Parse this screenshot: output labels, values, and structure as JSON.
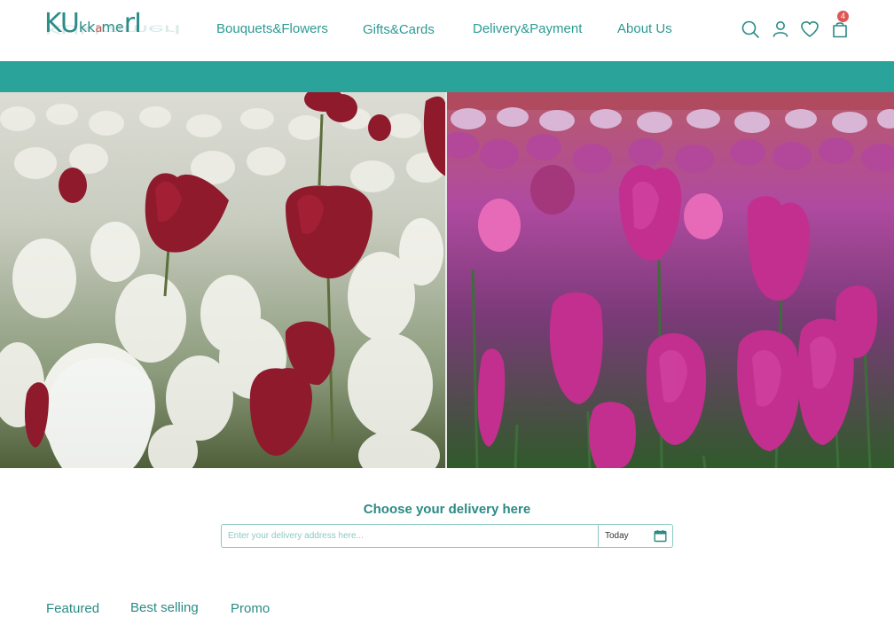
{
  "brand": {
    "logo_text": [
      "KU",
      "kk",
      "a",
      "me",
      "rI"
    ]
  },
  "nav": {
    "items": [
      {
        "label": "Bouquets&Flowers"
      },
      {
        "label": "Gifts&Cards"
      },
      {
        "label": "Delivery&Payment"
      },
      {
        "label": "About Us"
      }
    ]
  },
  "header_icons": {
    "search": "search-icon",
    "account": "user-icon",
    "wishlist": "heart-icon",
    "cart": "shopping-bag-icon",
    "cart_count": "4"
  },
  "colors": {
    "accent": "#2aa39b",
    "badge": "#e05656"
  },
  "hero": {
    "left_image": "white and red tulips",
    "right_image": "pink and purple tulips"
  },
  "delivery": {
    "title": "Choose your delivery here",
    "address_placeholder": "Enter your delivery address here...",
    "date_value": "Today",
    "date_icon": "calendar-icon"
  },
  "tabs": [
    {
      "label": "Featured"
    },
    {
      "label": "Best selling"
    },
    {
      "label": "Promo"
    }
  ]
}
